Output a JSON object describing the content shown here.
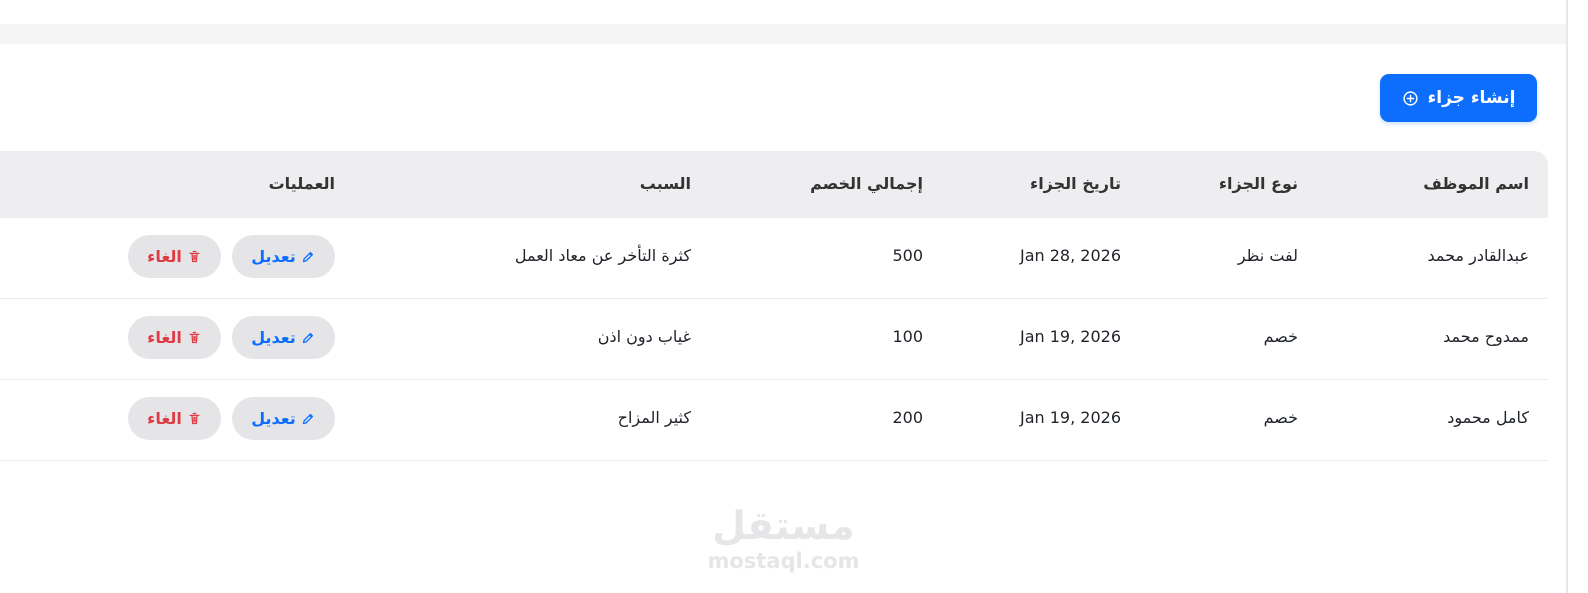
{
  "header": {
    "create_button_label": "إنشاء جزاء"
  },
  "table": {
    "columns": [
      "اسم الموظف",
      "نوع الجزاء",
      "تاريخ الجزاء",
      "إجمالي الخصم",
      "السبب",
      "العمليات"
    ],
    "rows": [
      {
        "employee_name": "عبدالقادر محمد",
        "penalty_type": "لفت نظر",
        "penalty_date": "Jan 28, 2026",
        "total_deduction": "500",
        "reason": "كثرة التأخر عن معاد العمل",
        "edit_label": "تعديل",
        "cancel_label": "الغاء"
      },
      {
        "employee_name": "ممدوح محمد",
        "penalty_type": "خصم",
        "penalty_date": "Jan 19, 2026",
        "total_deduction": "100",
        "reason": "غياب دون اذن",
        "edit_label": "تعديل",
        "cancel_label": "الغاء"
      },
      {
        "employee_name": "كامل محمود",
        "penalty_type": "خصم",
        "penalty_date": "Jan 19, 2026",
        "total_deduction": "200",
        "reason": "كثير المزاح",
        "edit_label": "تعديل",
        "cancel_label": "الغاء"
      }
    ]
  },
  "watermark": {
    "arabic": "مستقل",
    "domain": "mostaql.com"
  },
  "colors": {
    "primary": "#0d6efd",
    "danger": "#df3b45",
    "header_background": "#eeeef0",
    "pill_background": "#e5e5e8"
  },
  "icons": {
    "create": "plus-circle-icon",
    "edit": "pencil-icon",
    "cancel": "trash-icon"
  }
}
